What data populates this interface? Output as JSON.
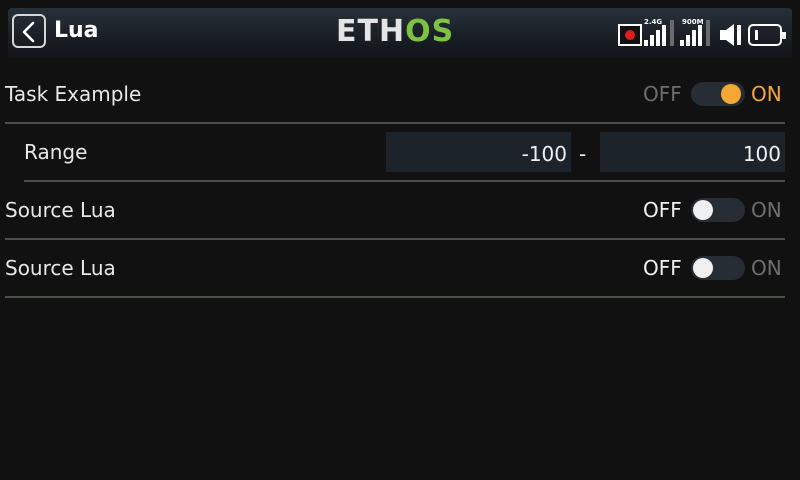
{
  "header": {
    "title": "Lua",
    "logo_main": "ETH",
    "logo_accent": "OS",
    "rf_24_label": "2.4G",
    "rf_900_label": "900M"
  },
  "rows": [
    {
      "label": "Task Example",
      "off": "OFF",
      "on": "ON",
      "state": "on"
    },
    {
      "label": "Range",
      "min": "-100",
      "separator": "-",
      "max": "100"
    },
    {
      "label": "Source Lua",
      "off": "OFF",
      "on": "ON",
      "state": "off"
    },
    {
      "label": "Source Lua",
      "off": "OFF",
      "on": "ON",
      "state": "off"
    }
  ],
  "colors": {
    "accent_on": "#f5a733",
    "logo_green": "#7fc241",
    "record_red": "#e01c1c"
  }
}
